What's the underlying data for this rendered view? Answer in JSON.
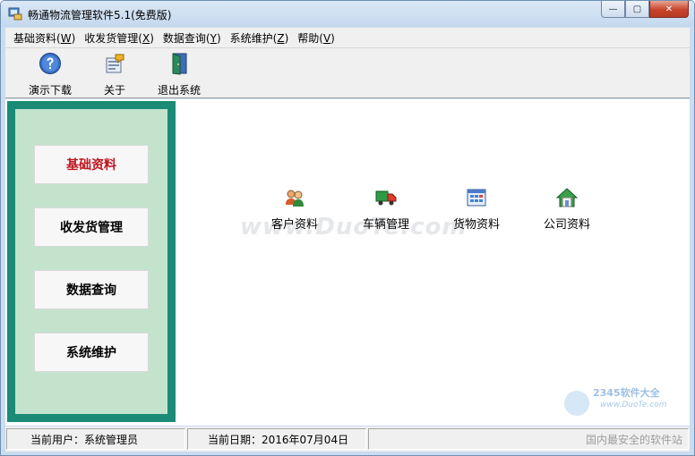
{
  "window": {
    "title": "畅通物流管理软件5.1(免费版)",
    "controls": {
      "minimize": "—",
      "maximize": "▢",
      "close": "✕"
    }
  },
  "menu": [
    {
      "label": "基础资料",
      "mnemonic": "W"
    },
    {
      "label": "收发货管理",
      "mnemonic": "X"
    },
    {
      "label": "数据查询",
      "mnemonic": "Y"
    },
    {
      "label": "系统维护",
      "mnemonic": "Z"
    },
    {
      "label": "帮助",
      "mnemonic": "V"
    }
  ],
  "toolbar": [
    {
      "label": "演示下载",
      "icon": "help-icon"
    },
    {
      "label": "关于",
      "icon": "about-icon"
    },
    {
      "label": "退出系统",
      "icon": "exit-door-icon"
    }
  ],
  "sidebar": {
    "items": [
      {
        "label": "基础资料",
        "active": true
      },
      {
        "label": "收发货管理",
        "active": false
      },
      {
        "label": "数据查询",
        "active": false
      },
      {
        "label": "系统维护",
        "active": false
      }
    ],
    "active_color": "#c0141e",
    "frame_color": "#1b8a76",
    "panel_color": "#c4e3cd"
  },
  "modules": [
    {
      "label": "客户资料",
      "icon": "customers-icon"
    },
    {
      "label": "车辆管理",
      "icon": "truck-icon"
    },
    {
      "label": "货物资料",
      "icon": "goods-grid-icon"
    },
    {
      "label": "公司资料",
      "icon": "company-house-icon"
    }
  ],
  "watermark": "www.DuoTe.com",
  "corner_logo": {
    "brand": "2345软件大全",
    "url": "www.DuoTe.com",
    "slogan": "国内最安全的软件站"
  },
  "status": {
    "user_label": "当前用户：系统管理员",
    "date_label": "当前日期：2016年07月04日"
  }
}
